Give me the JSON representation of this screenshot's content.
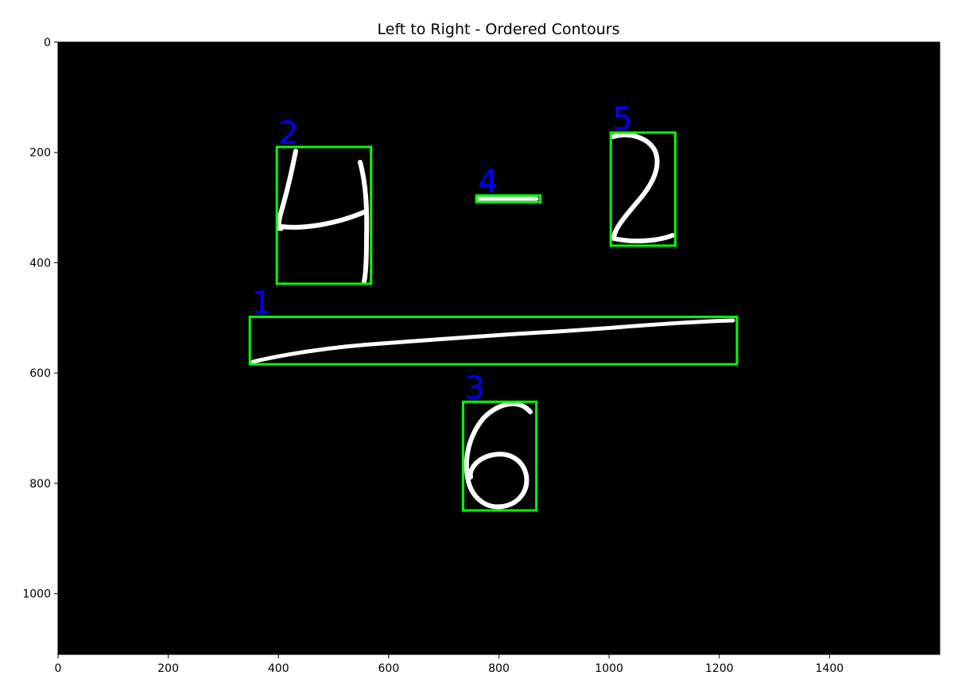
{
  "figure": {
    "title": "Left to Right - Ordered Contours"
  },
  "image_axes": {
    "x_ticks": [
      "0",
      "200",
      "400",
      "600",
      "800",
      "1000",
      "1200",
      "1400"
    ],
    "y_ticks": [
      "0",
      "200",
      "400",
      "600",
      "800",
      "1000"
    ],
    "x_range": [
      0,
      1600
    ],
    "y_range": [
      0,
      1110
    ],
    "y_inverted": true
  },
  "colors": {
    "image_background": "#000000",
    "stroke": "#ffffff",
    "box": "#00ff00",
    "label": "#0000ff"
  },
  "contours": [
    {
      "label": "1",
      "digit_drawn": "horizontal line",
      "box": [
        348,
        498,
        1232,
        584
      ]
    },
    {
      "label": "2",
      "digit_drawn": "4",
      "box": [
        397,
        190,
        568,
        438
      ]
    },
    {
      "label": "3",
      "digit_drawn": "6",
      "box": [
        735,
        652,
        868,
        849
      ]
    },
    {
      "label": "4",
      "digit_drawn": "minus",
      "box": [
        759,
        278,
        875,
        290
      ]
    },
    {
      "label": "5",
      "digit_drawn": "2",
      "box": [
        1003,
        164,
        1120,
        369
      ]
    }
  ]
}
